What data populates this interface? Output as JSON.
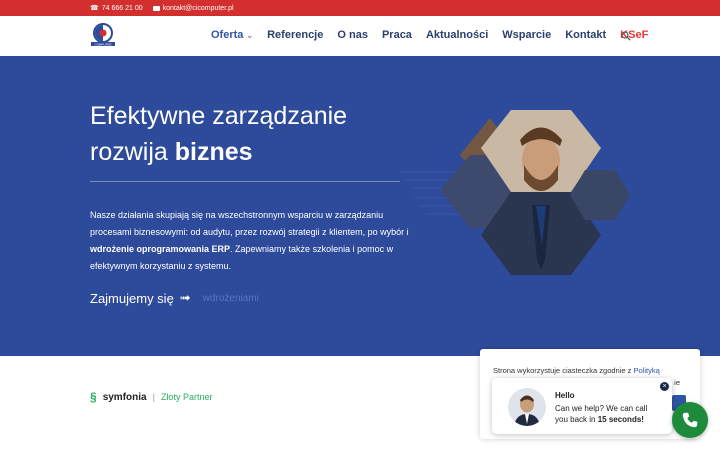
{
  "topbar": {
    "phone": "74 666 21 00",
    "email": "kontakt@cicomputer.pl"
  },
  "header": {
    "logo_text": "COMPUTER",
    "nav": [
      {
        "label": "Oferta",
        "has_dropdown": true
      },
      {
        "label": "Referencje"
      },
      {
        "label": "O nas"
      },
      {
        "label": "Praca"
      },
      {
        "label": "Aktualności"
      },
      {
        "label": "Wsparcie"
      },
      {
        "label": "Kontakt"
      },
      {
        "label": "KSeF"
      }
    ],
    "search_icon": "search-icon"
  },
  "hero": {
    "title_line1": "Efektywne zarządzanie",
    "title_line2_plain": "rozwija ",
    "title_line2_bold": "biznes",
    "desc_part1": "Nasze działania skupiają się na wszechstronnym wsparciu w zarządzaniu procesami biznesowymi: od audytu, przez rozwój strategii z klientem, po wybór i ",
    "desc_bold": "wdrożenie oprogramowania ERP",
    "desc_part2": ". Zapewniamy także szkolenia i pomoc w efektywnym korzystaniu z systemu.",
    "cta_text": "Zajmujemy się",
    "cta_arrow": "➟",
    "cta_rotating": "wdrożeniami"
  },
  "partner": {
    "brand": "symfonia",
    "separator": "|",
    "level": "Złoty Partner"
  },
  "cookie": {
    "text": "Strona wykorzystuje ciasteczka zgodnie z ",
    "link": "Polityką",
    "more": "ie"
  },
  "chat": {
    "hello": "Hello",
    "msg_part1": "Can we help? We can call you back in ",
    "msg_bold": "15 seconds!",
    "close": "×"
  },
  "colors": {
    "topbar": "#d32f2f",
    "hero": "#2e4a9a",
    "nav_text": "#2b3f6c",
    "ksef": "#e53935",
    "call_button": "#1e8a3c"
  }
}
